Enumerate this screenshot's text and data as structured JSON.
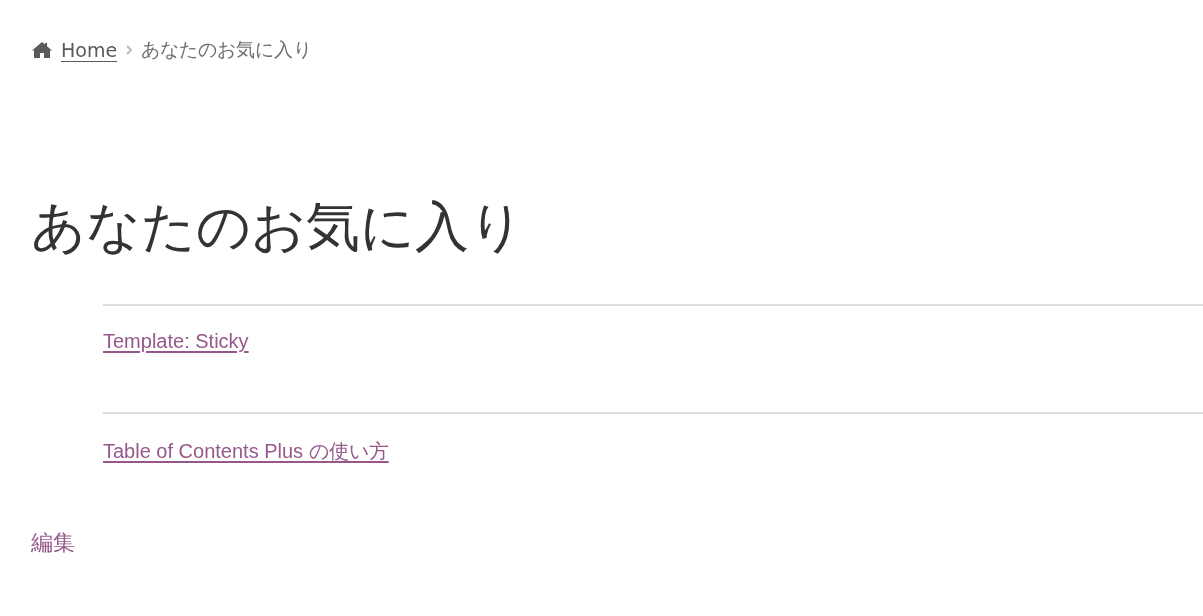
{
  "breadcrumb": {
    "home": "Home",
    "current": "あなたのお気に入り"
  },
  "title": "あなたのお気に入り",
  "favorites": [
    {
      "label": "Template: Sticky"
    },
    {
      "label": "Table of Contents Plus の使い方"
    }
  ],
  "edit_link": "編集"
}
